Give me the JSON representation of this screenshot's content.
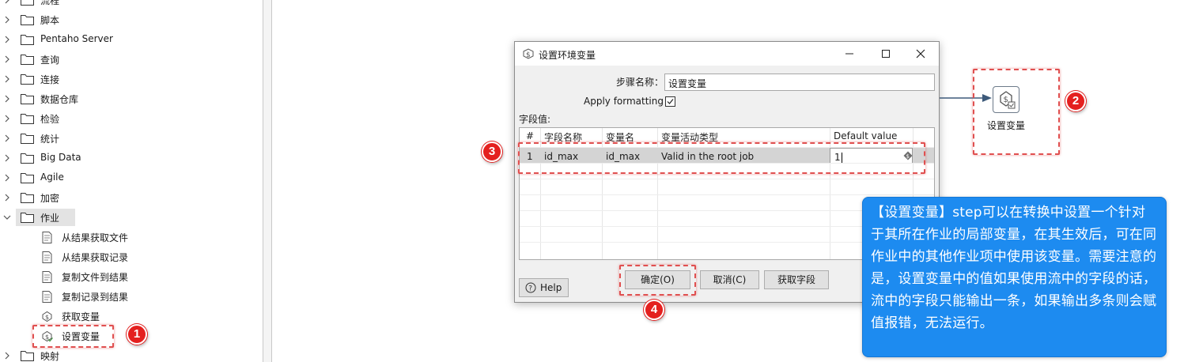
{
  "tree": {
    "folders_top": [
      {
        "label": "流程"
      },
      {
        "label": "脚本"
      },
      {
        "label": "Pentaho Server"
      },
      {
        "label": "查询"
      },
      {
        "label": "连接"
      },
      {
        "label": "数据仓库"
      },
      {
        "label": "检验"
      },
      {
        "label": "统计"
      },
      {
        "label": "Big Data"
      },
      {
        "label": "Agile"
      },
      {
        "label": "加密"
      }
    ],
    "expanded_folder": {
      "label": "作业",
      "expanded": true,
      "selected": true
    },
    "children": [
      {
        "label": "从结果获取文件",
        "icon": "get-files-from-result-icon"
      },
      {
        "label": "从结果获取记录",
        "icon": "get-rows-from-result-icon"
      },
      {
        "label": "复制文件到结果",
        "icon": "copy-files-to-result-icon"
      },
      {
        "label": "复制记录到结果",
        "icon": "copy-rows-to-result-icon"
      },
      {
        "label": "获取变量",
        "icon": "get-variables-icon"
      },
      {
        "label": "设置变量",
        "icon": "set-variables-icon",
        "highlighted": true
      }
    ],
    "folders_bottom": [
      {
        "label": "映射"
      }
    ]
  },
  "dialog": {
    "title": "设置环境变量",
    "step_name_label": "步骤名称：",
    "step_name_value": "设置变量",
    "apply_formatting_label": "Apply formatting",
    "apply_formatting_checked": true,
    "fields_label": "字段值:",
    "grid": {
      "headers": [
        "#",
        "字段名称",
        "变量名",
        "变量活动类型",
        "Default value"
      ],
      "rows": [
        {
          "num": "1",
          "field": "id_max",
          "variable": "id_max",
          "scope": "Valid in the root job",
          "default": "1"
        }
      ]
    },
    "buttons": {
      "help": "Help",
      "ok": "确定(O)",
      "cancel": "取消(C)",
      "get_fields": "获取字段"
    }
  },
  "canvas": {
    "node_label": "设置变量"
  },
  "badges": [
    "1",
    "2",
    "3",
    "4"
  ],
  "note": {
    "text": "【设置变量】step可以在转换中设置一个针对于其所在作业的局部变量，在其生效后，可在同作业中的其他作业项中使用该变量。需要注意的是，设置变量中的值如果使用流中的字段的话，流中的字段只能输出一条，如果输出多条则会赋值报错，无法运行。"
  },
  "colors": {
    "badge": "#e4201f",
    "callout_frame": "#e05050",
    "note_bg": "#1d8bf0",
    "selected_row": "#d4d4d4"
  }
}
